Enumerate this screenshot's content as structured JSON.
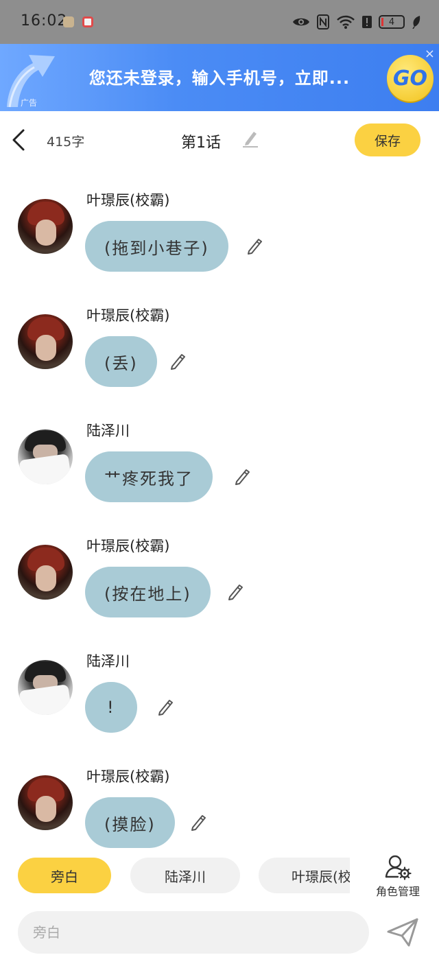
{
  "status_bar": {
    "time": "16:02",
    "battery_level": "4",
    "icons": [
      "eye-icon",
      "nfc-icon",
      "wifi-icon",
      "alert-icon",
      "battery-icon",
      "leaf-icon"
    ]
  },
  "ad_banner": {
    "text": "您还未登录，输入手机号，立即...",
    "label": "广告",
    "button_label": "GO",
    "close_label": "×"
  },
  "header": {
    "word_count": "415字",
    "chapter_title": "第1话",
    "save_label": "保存"
  },
  "messages": [
    {
      "speaker": "叶璟辰(校霸)",
      "text": "(拖到小巷子)",
      "avatar": "avatar-ye-jingchen"
    },
    {
      "speaker": "叶璟辰(校霸)",
      "text": "(丢)",
      "avatar": "avatar-ye-jingchen"
    },
    {
      "speaker": "陆泽川",
      "text": "艹疼死我了",
      "avatar": "avatar-lu-zechuan"
    },
    {
      "speaker": "叶璟辰(校霸)",
      "text": "(按在地上)",
      "avatar": "avatar-ye-jingchen"
    },
    {
      "speaker": "陆泽川",
      "text": "!",
      "avatar": "avatar-lu-zechuan"
    },
    {
      "speaker": "叶璟辰(校霸)",
      "text": "(摸脸)",
      "avatar": "avatar-ye-jingchen"
    }
  ],
  "roles": {
    "chips": [
      "旁白",
      "陆泽川",
      "叶璟辰(校霸)"
    ],
    "selected": "旁白",
    "manage_label": "角色管理"
  },
  "input": {
    "placeholder": "旁白"
  },
  "colors": {
    "accent": "#fbd142",
    "bubble": "#a9cbd6",
    "chip_bg": "#f1f1f1",
    "status_bar_bg": "#8e8e8e",
    "ad_blue": "#3d7ef0"
  }
}
